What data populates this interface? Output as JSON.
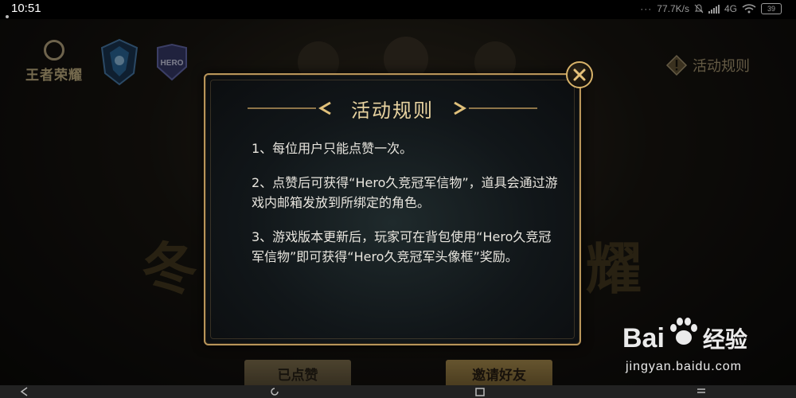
{
  "status_bar": {
    "time": "10:51",
    "net_speed": "77.7K/s",
    "network": "4G",
    "battery": "39"
  },
  "background": {
    "logo_text": "王者荣耀",
    "hero_logo_text": "HERO",
    "rules_button_label": "活动规则",
    "big_text_left": "冬",
    "big_text_right": "耀",
    "liked_button_label": "已点赞",
    "invite_button_label": "邀请好友"
  },
  "modal": {
    "title": "活动规则",
    "rules": [
      "1、每位用户只能点赞一次。",
      "2、点赞后可获得“Hero久竞冠军信物”，道具会通过游戏内邮箱发放到所绑定的角色。",
      "3、游戏版本更新后，玩家可在背包使用“Hero久竞冠军信物”即可获得“Hero久竞冠军头像框”奖励。"
    ]
  },
  "watermark": {
    "brand": "Bai",
    "brand_suffix": "经验",
    "url": "jingyan.baidu.com"
  },
  "colors": {
    "accent_gold": "#b8955a",
    "title_gold": "#e8d3a0"
  },
  "icons": {
    "close": "close-icon",
    "warning": "warning-icon",
    "wifi": "wifi-icon",
    "signal": "signal-icon",
    "mute": "bell-off-icon"
  }
}
